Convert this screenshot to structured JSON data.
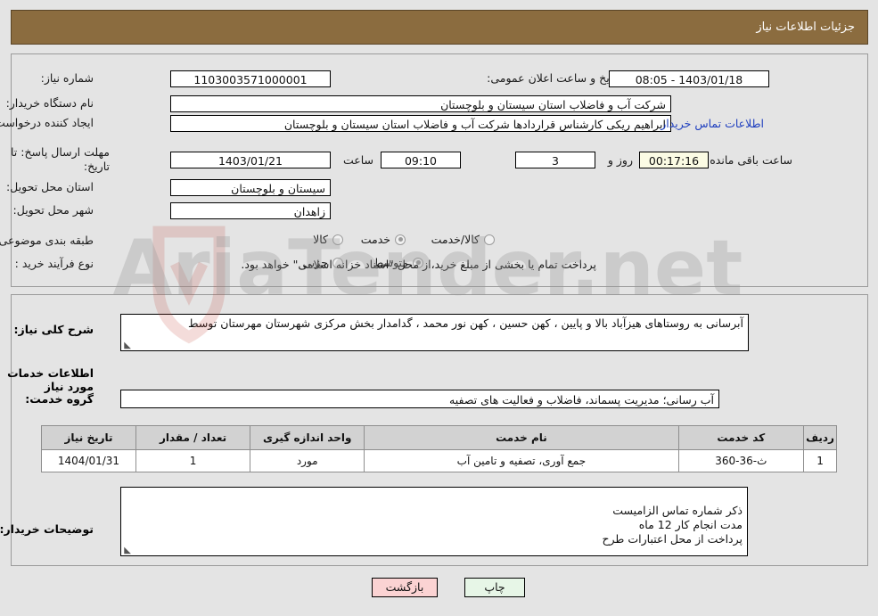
{
  "header": {
    "title": "جزئیات اطلاعات نیاز"
  },
  "top_panel": {
    "need_number_label": "شماره نیاز:",
    "need_number_value": "1103003571000001",
    "announce_label": "تاریخ و ساعت اعلان عمومی:",
    "announce_value": "1403/01/18 - 08:05",
    "buyer_org_label": "نام دستگاه خریدار:",
    "buyer_org_value": "شرکت آب و فاضلاب استان سیستان و بلوچستان",
    "requester_label": "ایجاد کننده درخواست:",
    "requester_value": "ابراهیم ریکی کارشناس قراردادها شرکت آب و فاضلاب استان سیستان و بلوچستان",
    "contact_link": "اطلاعات تماس خریدار",
    "deadline_label": "مهلت ارسال پاسخ: تا تاریخ:",
    "deadline_date": "1403/01/21",
    "time_label": "ساعت",
    "deadline_time": "09:10",
    "days_value": "3",
    "days_label": "روز و",
    "countdown_value": "00:17:16",
    "remaining_label": "ساعت باقی مانده",
    "province_label": "استان محل تحویل:",
    "province_value": "سیستان و بلوچستان",
    "city_label": "شهر محل تحویل:",
    "city_value": "زاهدان",
    "category_label": "طبقه بندی موضوعی:",
    "category_options": [
      {
        "label": "کالا",
        "selected": false
      },
      {
        "label": "خدمت",
        "selected": true
      },
      {
        "label": "کالا/خدمت",
        "selected": false
      }
    ],
    "process_label": "نوع فرآیند خرید :",
    "process_options": [
      {
        "label": "جزیی",
        "selected": false
      },
      {
        "label": "متوسط",
        "selected": true
      }
    ],
    "payment_note": "پرداخت تمام یا بخشی از مبلغ خرید،از محل \"اسناد خزانه اسلامی\" خواهد بود."
  },
  "bottom_panel": {
    "summary_label": "شرح کلی نیاز:",
    "summary_value": "آبرسانی به روستاهای هیزآباد بالا و پایین ، کهن حسین ، کهن نور محمد ، گدامدار بخش مرکزی شهرستان مهرستان توسط",
    "services_heading": "اطلاعات خدمات مورد نیاز",
    "service_group_label": "گروه خدمت:",
    "service_group_value": "آب رسانی؛ مدیریت پسماند، فاضلاب و فعالیت های تصفیه",
    "table": {
      "headers": [
        "ردیف",
        "کد خدمت",
        "نام خدمت",
        "واحد اندازه گیری",
        "تعداد / مقدار",
        "تاریخ نیاز"
      ],
      "rows": [
        [
          "1",
          "ث-36-360",
          "جمع آوری، تصفیه و تامین آب",
          "مورد",
          "1",
          "1404/01/31"
        ]
      ]
    },
    "notes_label": "توضیحات خریدار:",
    "notes_value": "ذکر شماره تماس الزامیست\nمدت انجام کار 12 ماه\nپرداخت از محل اعتبارات طرح"
  },
  "footer": {
    "print_label": "چاپ",
    "back_label": "بازگشت"
  },
  "watermark": {
    "text": "AriaTender.net"
  },
  "colors": {
    "header_bar": "#8b6c3f",
    "page_bg": "#e4e4e4",
    "link": "#1f3fbf",
    "print_btn": "#e7f6e7",
    "back_btn": "#fbd3d3",
    "timer_field": "#fbfbe4"
  }
}
